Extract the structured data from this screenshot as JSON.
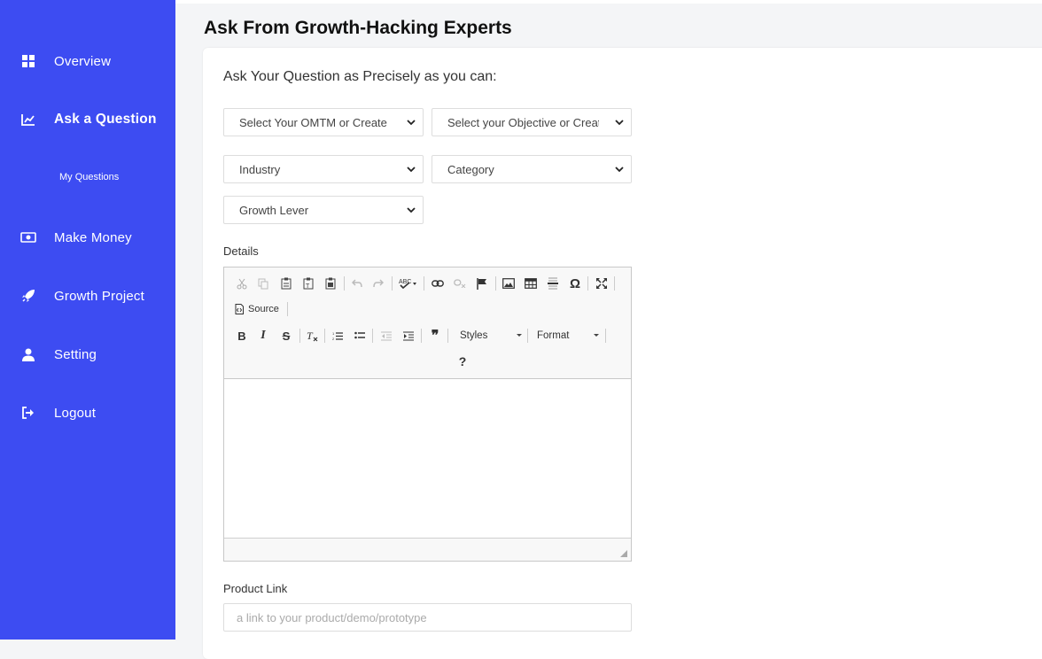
{
  "sidebar": {
    "items": [
      {
        "label": "Overview",
        "icon": "grid-icon"
      },
      {
        "label": "Ask a Question",
        "icon": "chart-line-icon",
        "active": true
      },
      {
        "label": "My Questions",
        "icon": ""
      },
      {
        "label": "Make Money",
        "icon": "money-icon"
      },
      {
        "label": "Growth Project",
        "icon": "rocket-icon"
      },
      {
        "label": "Setting",
        "icon": "user-icon"
      },
      {
        "label": "Logout",
        "icon": "logout-icon"
      }
    ],
    "color": "#3d4cf2"
  },
  "page": {
    "title": "Ask From Growth-Hacking Experts",
    "question_heading": "Ask Your Question as Precisely as you can:"
  },
  "selects": {
    "omtm": "Select Your OMTM or Create",
    "objective": "Select your Objective or Create",
    "industry": "Industry",
    "category": "Category",
    "growth_lever": "Growth Lever"
  },
  "details": {
    "label": "Details",
    "toolbar": {
      "source_label": "Source",
      "styles_label": "Styles",
      "format_label": "Format",
      "help_label": "?"
    }
  },
  "product_link": {
    "label": "Product Link",
    "placeholder": "a link to your product/demo/prototype"
  }
}
